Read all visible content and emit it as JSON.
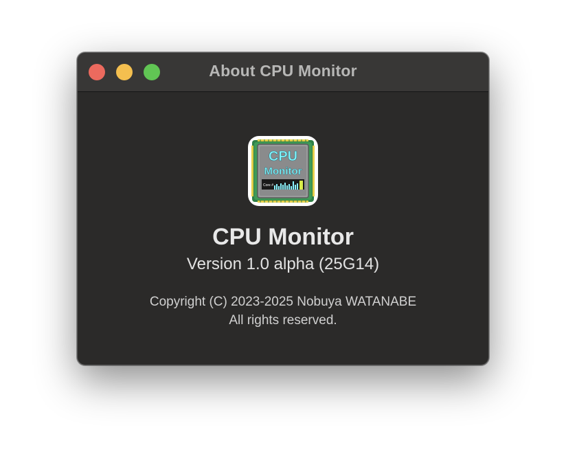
{
  "window": {
    "title": "About CPU Monitor"
  },
  "traffic_lights": {
    "close_color": "#ec6a5e",
    "minimize_color": "#f4bf4f",
    "zoom_color": "#61c554"
  },
  "app_icon": {
    "icon": "cpu-chip-icon",
    "line1": "CPU",
    "line2": "Monitor",
    "graph_label": "Core #",
    "accent_color": "#7ff6ff"
  },
  "about": {
    "app_name": "CPU Monitor",
    "version": "Version 1.0 alpha (25G14)",
    "copyright": "Copyright (C) 2023-2025 Nobuya WATANABE",
    "rights": "All rights reserved."
  }
}
